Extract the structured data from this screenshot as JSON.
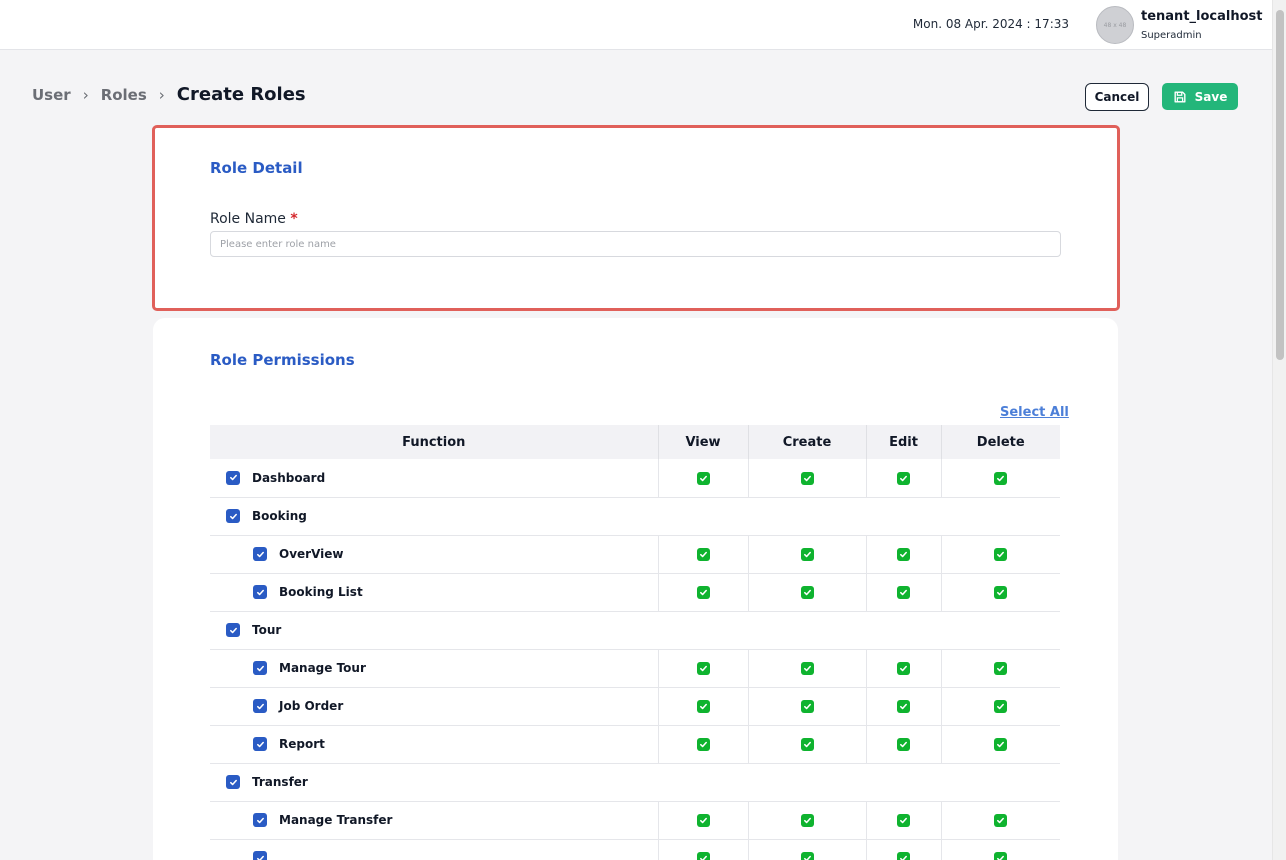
{
  "header": {
    "datetime": "Mon. 08 Apr. 2024 : 17:33",
    "avatar_placeholder": "48 x 48",
    "user_name": "tenant_localhost",
    "user_role": "Superadmin"
  },
  "breadcrumb": {
    "items": [
      "User",
      "Roles"
    ],
    "current": "Create Roles"
  },
  "actions": {
    "cancel_label": "Cancel",
    "save_label": "Save"
  },
  "role_detail": {
    "title": "Role Detail",
    "role_name_label": "Role Name",
    "required_mark": "*",
    "role_name_placeholder": "Please enter role name",
    "role_name_value": ""
  },
  "role_permissions": {
    "title": "Role Permissions",
    "select_all_label": "Select All",
    "columns": [
      "Function",
      "View",
      "Create",
      "Edit",
      "Delete"
    ],
    "rows": [
      {
        "name": "Dashboard",
        "level": 0,
        "checked": true,
        "has_perms": true,
        "view": true,
        "create": true,
        "edit": true,
        "delete": true
      },
      {
        "name": "Booking",
        "level": 0,
        "checked": true,
        "has_perms": false
      },
      {
        "name": "OverView",
        "level": 1,
        "checked": true,
        "has_perms": true,
        "view": true,
        "create": true,
        "edit": true,
        "delete": true
      },
      {
        "name": "Booking List",
        "level": 1,
        "checked": true,
        "has_perms": true,
        "view": true,
        "create": true,
        "edit": true,
        "delete": true
      },
      {
        "name": "Tour",
        "level": 0,
        "checked": true,
        "has_perms": false
      },
      {
        "name": "Manage Tour",
        "level": 1,
        "checked": true,
        "has_perms": true,
        "view": true,
        "create": true,
        "edit": true,
        "delete": true
      },
      {
        "name": "Job Order",
        "level": 1,
        "checked": true,
        "has_perms": true,
        "view": true,
        "create": true,
        "edit": true,
        "delete": true
      },
      {
        "name": "Report",
        "level": 1,
        "checked": true,
        "has_perms": true,
        "view": true,
        "create": true,
        "edit": true,
        "delete": true
      },
      {
        "name": "Transfer",
        "level": 0,
        "checked": true,
        "has_perms": false
      },
      {
        "name": "Manage Transfer",
        "level": 1,
        "checked": true,
        "has_perms": true,
        "view": true,
        "create": true,
        "edit": true,
        "delete": true
      },
      {
        "name": "",
        "level": 1,
        "checked": true,
        "has_perms": true,
        "view": true,
        "create": true,
        "edit": true,
        "delete": true
      }
    ]
  },
  "colors": {
    "accent_blue": "#2a5bc4",
    "save_green": "#23b67a",
    "check_green": "#0fb32f",
    "highlight_red": "#e0605a"
  }
}
